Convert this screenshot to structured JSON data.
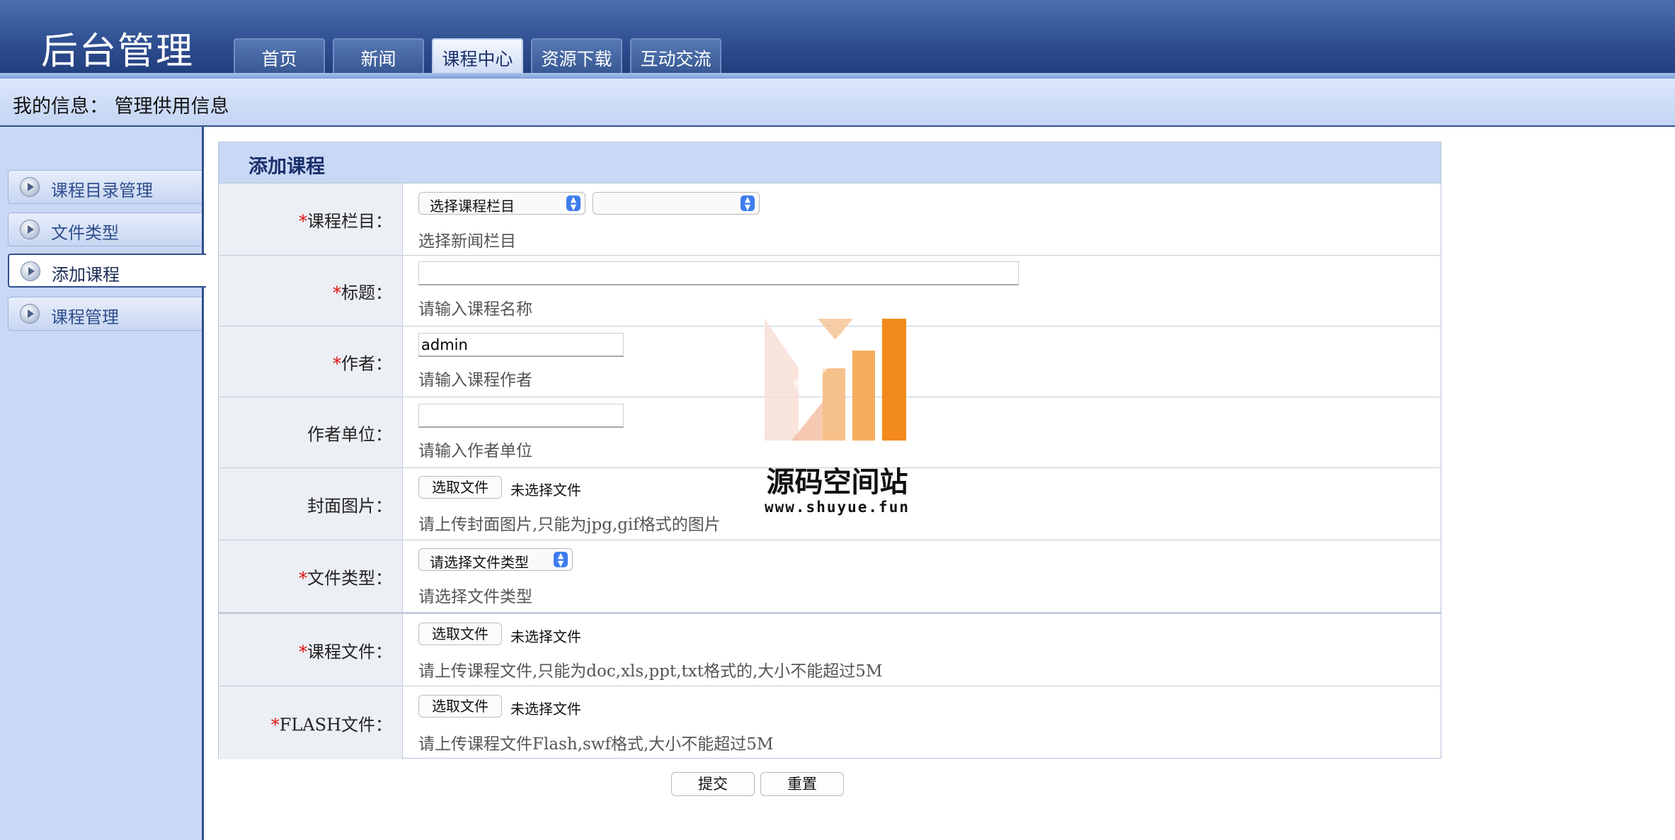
{
  "app": {
    "title": "后台管理"
  },
  "nav": {
    "tabs": [
      {
        "label": "首页"
      },
      {
        "label": "新闻"
      },
      {
        "label": "课程中心",
        "active": true
      },
      {
        "label": "资源下载"
      },
      {
        "label": "互动交流"
      }
    ]
  },
  "infobar": {
    "text": "我的信息： 管理供用信息"
  },
  "sidebar": {
    "items": [
      {
        "label": "课程目录管理"
      },
      {
        "label": "文件类型"
      },
      {
        "label": "添加课程",
        "active": true
      },
      {
        "label": "课程管理"
      }
    ]
  },
  "form": {
    "title": "添加课程",
    "required_mark": "*",
    "category": {
      "label": "课程栏目：",
      "select_primary": "选择课程栏目",
      "select_secondary": "",
      "hint": "选择新闻栏目"
    },
    "title_field": {
      "label": "标题：",
      "value": "",
      "hint": "请输入课程名称"
    },
    "author": {
      "label": "作者：",
      "value": "admin",
      "hint": "请输入课程作者"
    },
    "author_unit": {
      "label": "作者单位：",
      "value": "",
      "hint": "请输入作者单位"
    },
    "cover": {
      "label": "封面图片：",
      "button": "选取文件",
      "status": "未选择文件",
      "hint": "请上传封面图片,只能为jpg,gif格式的图片"
    },
    "file_type": {
      "label": "文件类型：",
      "select": "请选择文件类型",
      "hint": "请选择文件类型"
    },
    "course_file": {
      "label": "课程文件：",
      "button": "选取文件",
      "status": "未选择文件",
      "hint": "请上传课程文件,只能为doc,xls,ppt,txt格式的,大小不能超过5M"
    },
    "flash_file": {
      "label": "FLASH文件：",
      "button": "选取文件",
      "status": "未选择文件",
      "hint": "请上传课程文件Flash,swf格式,大小不能超过5M"
    },
    "submit_label": "提交",
    "reset_label": "重置"
  },
  "watermark": {
    "name": "源码空间站",
    "url": "www.shuyue.fun"
  },
  "colors": {
    "header": "#2f4f91",
    "panel_title": "#c9d8f5",
    "sidebar": "#c9d8f4",
    "required": "#dd1111",
    "watermark_orange": "#f39a2c"
  }
}
